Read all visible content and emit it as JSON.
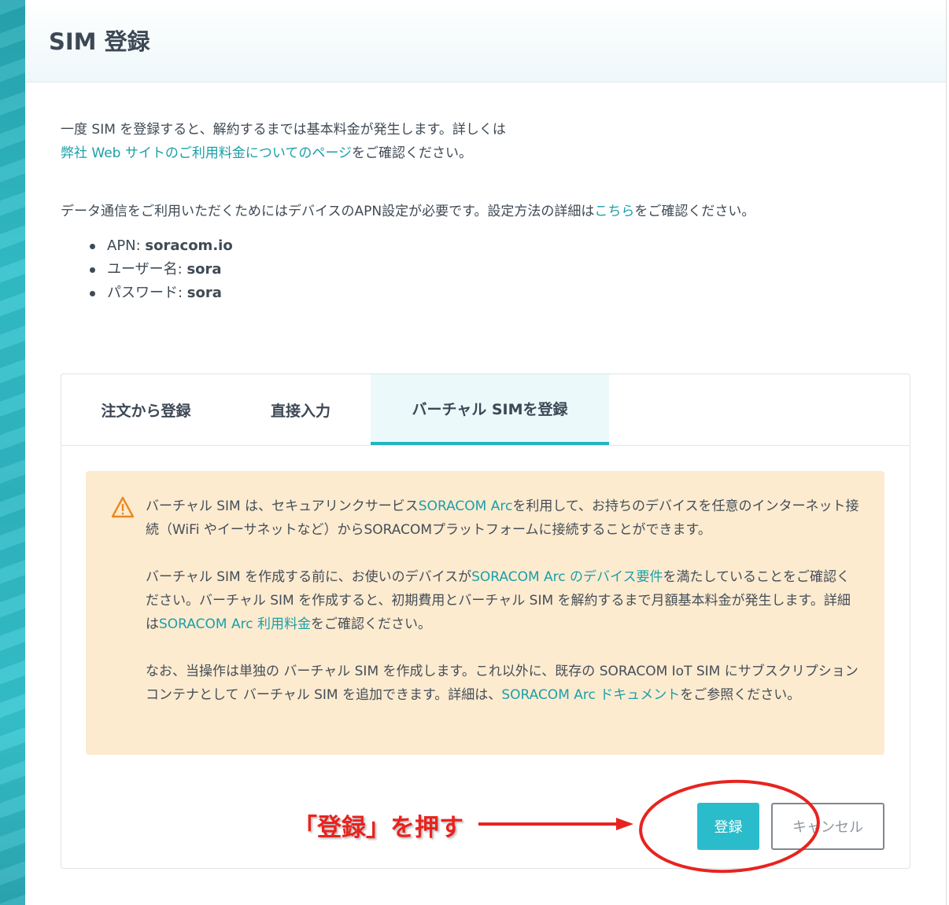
{
  "dialog": {
    "title": "SIM 登録"
  },
  "intro": {
    "line1": "一度 SIM を登録すると、解約するまでは基本料金が発生します。詳しくは",
    "pricing_link": "弊社 Web サイトのご利用料金についてのページ",
    "line2_suffix": "をご確認ください。",
    "apn_text": "データ通信をご利用いただくためにはデバイスのAPN設定が必要です。設定方法の詳細は",
    "apn_link": "こちら",
    "apn_suffix": "をご確認ください。"
  },
  "apn_settings": [
    {
      "label": "APN: ",
      "value": "soracom.io"
    },
    {
      "label": "ユーザー名: ",
      "value": "sora"
    },
    {
      "label": "パスワード: ",
      "value": "sora"
    }
  ],
  "tabs": [
    {
      "label": "注文から登録",
      "active": false
    },
    {
      "label": "直接入力",
      "active": false
    },
    {
      "label": "バーチャル SIMを登録",
      "active": true
    }
  ],
  "notice": {
    "p1_a": "バーチャル SIM は、セキュアリンクサービス",
    "p1_link": "SORACOM Arc",
    "p1_b": "を利用して、お持ちのデバイスを任意のインターネット接続（WiFi やイーサネットなど）からSORACOMプラットフォームに接続することができます。",
    "p2_a": "バーチャル SIM を作成する前に、お使いのデバイスが",
    "p2_link1": "SORACOM Arc のデバイス要件",
    "p2_b": "を満たしていることをご確認ください。バーチャル SIM を作成すると、初期費用とバーチャル SIM を解約するまで月額基本料金が発生します。詳細は",
    "p2_link2": "SORACOM Arc 利用料金",
    "p2_c": "をご確認ください。",
    "p3_a": "なお、当操作は単独の バーチャル SIM を作成します。これ以外に、既存の SORACOM IoT SIM にサブスクリプションコンテナとして バーチャル SIM を追加できます。詳細は、",
    "p3_link": "SORACOM Arc ドキュメント",
    "p3_b": "をご参照ください。",
    "icon": "warning-icon"
  },
  "buttons": {
    "register": "登録",
    "cancel": "キャンセル"
  },
  "annotation": {
    "text": "「登録」を押す"
  },
  "colors": {
    "accent": "#2bbccb",
    "link": "#1a9fa8",
    "notice_bg": "#fdebd0",
    "warning": "#e8891f",
    "annotation": "#e8231f"
  }
}
